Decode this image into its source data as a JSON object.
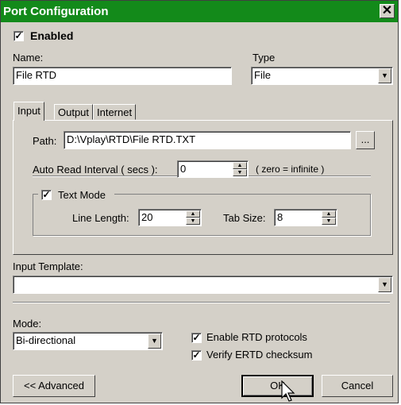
{
  "window": {
    "title": "Port Configuration",
    "close_glyph": "✕"
  },
  "enabled": {
    "label": "Enabled",
    "checked": true
  },
  "name": {
    "label": "Name:",
    "value": "File RTD"
  },
  "type": {
    "label": "Type",
    "value": "File"
  },
  "tabs": [
    {
      "label": "Input",
      "active": true
    },
    {
      "label": "Output",
      "active": false
    },
    {
      "label": "Internet",
      "active": false
    }
  ],
  "input_tab": {
    "path": {
      "label": "Path:",
      "value": "D:\\Vplay\\RTD\\File RTD.TXT",
      "browse_label": "..."
    },
    "auto_read": {
      "label": "Auto Read Interval ( secs ):",
      "value": "0",
      "hint": "( zero = infinite )"
    },
    "text_mode": {
      "label": "Text Mode",
      "checked": true,
      "line_length": {
        "label": "Line Length:",
        "value": "20"
      },
      "tab_size": {
        "label": "Tab Size:",
        "value": "8"
      }
    }
  },
  "input_template": {
    "label": "Input Template:",
    "value": ""
  },
  "mode": {
    "label": "Mode:",
    "value": "Bi-directional"
  },
  "options": {
    "enable_rtd": {
      "label": "Enable RTD protocols",
      "checked": true
    },
    "verify_ertd": {
      "label": "Verify ERTD checksum",
      "checked": true
    }
  },
  "buttons": {
    "advanced": "<< Advanced",
    "ok": "OK",
    "cancel": "Cancel"
  },
  "colors": {
    "titlebar": "#138a1a",
    "face": "#d4d0c8"
  }
}
